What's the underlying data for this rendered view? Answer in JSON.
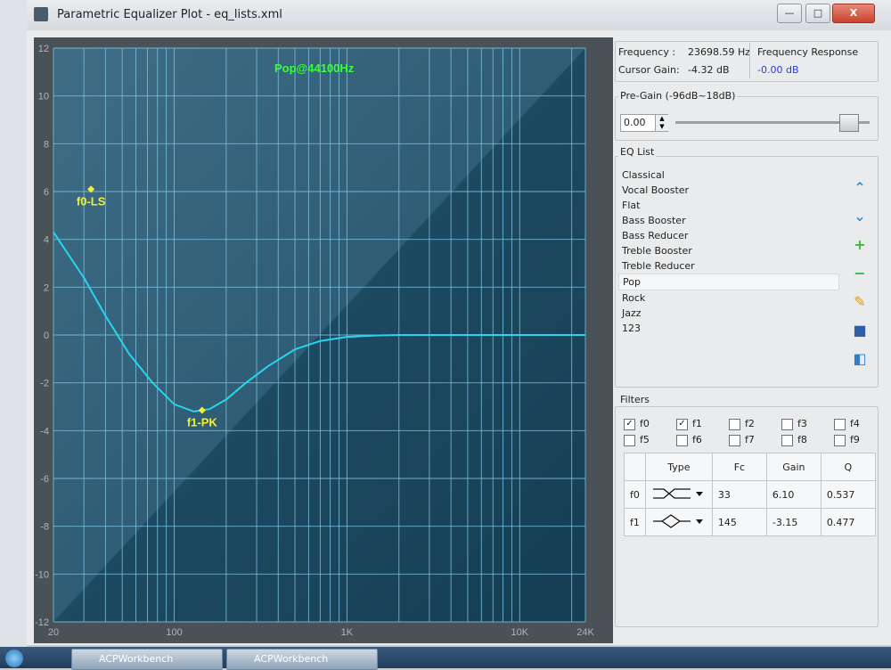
{
  "window": {
    "title": "Parametric Equalizer Plot - eq_lists.xml",
    "controls": {
      "minimize": "—",
      "restore": "□",
      "close": "X"
    }
  },
  "plot": {
    "title": "Pop@44100Hz",
    "y_ticks": [
      "12",
      "10",
      "8",
      "6",
      "4",
      "2",
      "0",
      "-2",
      "-4",
      "-6",
      "-8",
      "-10",
      "-12"
    ],
    "x_ticks": [
      "20",
      "100",
      "1K",
      "10K",
      "24K"
    ],
    "markers": [
      {
        "label": "f0-LS"
      },
      {
        "label": "f1-PK"
      }
    ]
  },
  "chart_data": {
    "type": "line",
    "title": "Pop@44100Hz",
    "xlabel": "",
    "ylabel": "",
    "x_scale": "log",
    "xlim": [
      20,
      24000
    ],
    "ylim": [
      -12,
      12
    ],
    "grid": true,
    "series": [
      {
        "x": [
          20,
          30,
          40,
          55,
          75,
          100,
          130,
          160,
          200,
          260,
          350,
          500,
          700,
          1000,
          1500,
          2000,
          3000,
          5000,
          10000,
          24000
        ],
        "values": [
          4.3,
          2.4,
          0.8,
          -0.8,
          -2.0,
          -2.9,
          -3.2,
          -3.1,
          -2.7,
          -2.0,
          -1.3,
          -0.6,
          -0.25,
          -0.08,
          -0.02,
          0,
          0,
          0,
          0,
          0
        ]
      }
    ],
    "points": [
      {
        "label": "f0-LS",
        "x": 33,
        "y": 6.1
      },
      {
        "label": "f1-PK",
        "x": 145,
        "y": -3.15
      }
    ]
  },
  "info": {
    "frequency_label": "Frequency :",
    "frequency_value": "23698.59 Hz",
    "cursor_gain_label": "Cursor Gain:",
    "cursor_gain_value": "-4.32 dB",
    "response_label": "Frequency Response",
    "response_value": "-0.00 dB"
  },
  "pregain": {
    "label": "Pre-Gain (-96dB~18dB)",
    "value": "0.00",
    "slider_level": 0.93
  },
  "eq_list": {
    "label": "EQ List",
    "items": [
      "Classical",
      "Vocal Booster",
      "Flat",
      "Bass Booster",
      "Bass Reducer",
      "Treble Booster",
      "Treble Reducer",
      "Pop",
      "Rock",
      "Jazz",
      "123"
    ],
    "selected": "Pop"
  },
  "side_icons": [
    "chevron-up-icon",
    "chevron-down-icon",
    "plus-icon",
    "minus-icon",
    "pencil-icon",
    "save-icon",
    "save-as-icon"
  ],
  "filters": {
    "label": "Filters",
    "checks": [
      {
        "label": "f0",
        "checked": true
      },
      {
        "label": "f1",
        "checked": true
      },
      {
        "label": "f2",
        "checked": false
      },
      {
        "label": "f3",
        "checked": false
      },
      {
        "label": "f4",
        "checked": false
      },
      {
        "label": "f5",
        "checked": false
      },
      {
        "label": "f6",
        "checked": false
      },
      {
        "label": "f7",
        "checked": false
      },
      {
        "label": "f8",
        "checked": false
      },
      {
        "label": "f9",
        "checked": false
      }
    ],
    "headers": [
      "Type",
      "Fc",
      "Gain",
      "Q"
    ],
    "rows": [
      {
        "name": "f0",
        "fc": "33",
        "gain": "6.10",
        "q": "0.537"
      },
      {
        "name": "f1",
        "fc": "145",
        "gain": "-3.15",
        "q": "0.477"
      }
    ]
  },
  "taskbar": {
    "items": [
      "ACPWorkbench",
      "ACPWorkbench"
    ]
  }
}
